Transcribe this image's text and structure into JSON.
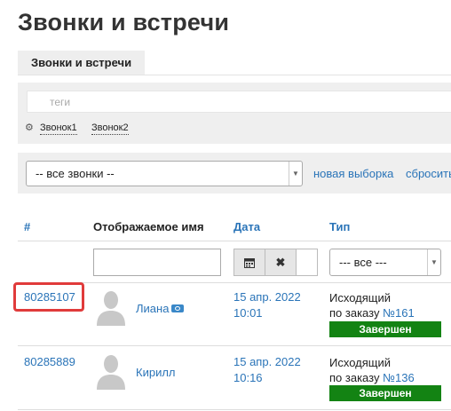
{
  "page": {
    "title": "Звонки и встречи"
  },
  "tabs": [
    {
      "label": "Звонки и встречи",
      "active": true
    }
  ],
  "filters": {
    "tags_placeholder": "теги",
    "saved_tags": [
      "Звонок1",
      "Звонок2"
    ],
    "select_value": "-- все звонки --",
    "new_selection": "новая выборка",
    "reset": "сбросить"
  },
  "table": {
    "headers": {
      "id": "#",
      "name": "Отображаемое имя",
      "date": "Дата",
      "type": "Тип"
    },
    "type_filter_value": "--- все ---",
    "rows": [
      {
        "id": "80285107",
        "name": "Лиана",
        "date": "15 апр. 2022",
        "time": "10:01",
        "direction": "Исходящий",
        "order_prefix": "по заказу",
        "order": "№161",
        "status": "Завершен",
        "has_badge_icon": true
      },
      {
        "id": "80285889",
        "name": "Кирилл",
        "date": "15 апр. 2022",
        "time": "10:16",
        "direction": "Исходящий",
        "order_prefix": "по заказу",
        "order": "№136",
        "status": "Завершен",
        "has_badge_icon": false
      }
    ]
  },
  "colors": {
    "link": "#2a74b8",
    "status_done": "#138313",
    "highlight": "#e03b3b"
  }
}
